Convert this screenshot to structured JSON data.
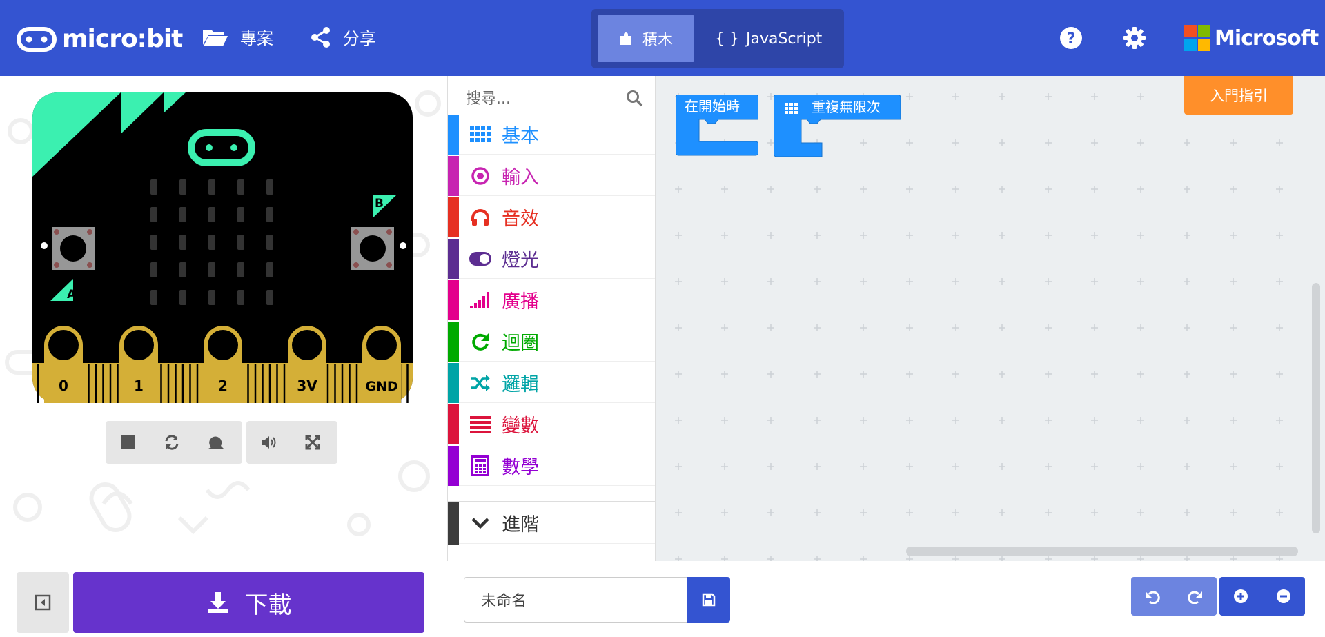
{
  "header": {
    "logo_text": "micro:bit",
    "projects_label": "專案",
    "share_label": "分享",
    "blocks_label": "積木",
    "javascript_label": "JavaScript",
    "microsoft_label": "Microsoft"
  },
  "simulator": {
    "pins": [
      "0",
      "1",
      "2",
      "3V",
      "GND"
    ],
    "button_a": "A",
    "button_b": "B"
  },
  "toolbox": {
    "search_placeholder": "搜尋...",
    "categories": [
      {
        "label": "基本",
        "color": "#1e90ff",
        "icon": "grid-icon"
      },
      {
        "label": "輸入",
        "color": "#c724b1",
        "icon": "target-icon"
      },
      {
        "label": "音效",
        "color": "#e63022",
        "icon": "headphones-icon"
      },
      {
        "label": "燈光",
        "color": "#5c2d91",
        "icon": "toggle-icon"
      },
      {
        "label": "廣播",
        "color": "#e3008c",
        "icon": "signal-icon"
      },
      {
        "label": "迴圈",
        "color": "#00aa00",
        "icon": "refresh-icon"
      },
      {
        "label": "邏輯",
        "color": "#00a4a6",
        "icon": "shuffle-icon"
      },
      {
        "label": "變數",
        "color": "#dc143c",
        "icon": "list-icon"
      },
      {
        "label": "數學",
        "color": "#9400d3",
        "icon": "calculator-icon"
      },
      {
        "label": "進階",
        "color": "#3c3c3c",
        "icon": "chevron-down-icon"
      }
    ]
  },
  "workspace": {
    "on_start_label": "在開始時",
    "forever_label": "重複無限次",
    "tutorial_label": "入門指引"
  },
  "bottom": {
    "download_label": "下載",
    "project_name": "未命名"
  },
  "colors": {
    "header": "#3454d1",
    "block": "#1e90ff",
    "download": "#6633cc",
    "tutorial": "#ff8f2a"
  }
}
